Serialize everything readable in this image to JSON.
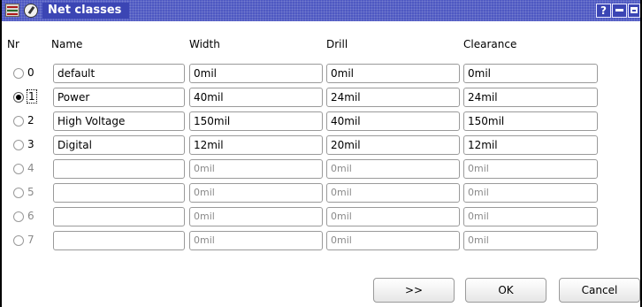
{
  "window": {
    "title": "Net classes"
  },
  "titlebar_buttons": {
    "help": "?"
  },
  "headers": {
    "nr": "Nr",
    "name": "Name",
    "width": "Width",
    "drill": "Drill",
    "clearance": "Clearance"
  },
  "rows": [
    {
      "nr": "0",
      "name": "default",
      "width": "0mil",
      "drill": "0mil",
      "clearance": "0mil",
      "enabled": true,
      "selected": false
    },
    {
      "nr": "1",
      "name": "Power",
      "width": "40mil",
      "drill": "24mil",
      "clearance": "24mil",
      "enabled": true,
      "selected": true
    },
    {
      "nr": "2",
      "name": "High Voltage",
      "width": "150mil",
      "drill": "40mil",
      "clearance": "150mil",
      "enabled": true,
      "selected": false
    },
    {
      "nr": "3",
      "name": "Digital",
      "width": "12mil",
      "drill": "20mil",
      "clearance": "12mil",
      "enabled": true,
      "selected": false
    },
    {
      "nr": "4",
      "name": "",
      "width": "0mil",
      "drill": "0mil",
      "clearance": "0mil",
      "enabled": false,
      "selected": false
    },
    {
      "nr": "5",
      "name": "",
      "width": "0mil",
      "drill": "0mil",
      "clearance": "0mil",
      "enabled": false,
      "selected": false
    },
    {
      "nr": "6",
      "name": "",
      "width": "0mil",
      "drill": "0mil",
      "clearance": "0mil",
      "enabled": false,
      "selected": false
    },
    {
      "nr": "7",
      "name": "",
      "width": "0mil",
      "drill": "0mil",
      "clearance": "0mil",
      "enabled": false,
      "selected": false
    }
  ],
  "buttons": {
    "more": ">>",
    "ok": "OK",
    "cancel": "Cancel"
  },
  "colors": {
    "titlebar": "#4d57c2",
    "text": "#000000",
    "disabled_text": "#8a8a8a"
  },
  "icons": {
    "app": "board-icon",
    "pin": "pin-icon"
  }
}
